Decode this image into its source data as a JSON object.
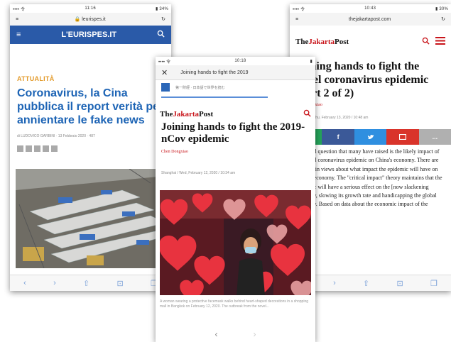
{
  "phone1": {
    "status_left": "•••• 令",
    "status_time": "11:16",
    "status_right": "▮ 34%",
    "url": "🔒 leurispes.it",
    "site_name": "L'EURISPES.IT",
    "section": "ATTUALITÀ",
    "headline": "Coronavirus, la Cina pubblica il report verità per annientare le fake news",
    "byline": "di LUDOVICO GARBINI · 13 Febbraio 2020 · 487"
  },
  "phone2": {
    "status_left": "•••• 令",
    "status_time": "10:18",
    "status_right": "▮",
    "tab_title": "Joining hands to fight the 2019",
    "banner_text": "第一財經 · 日本語で世界を読む",
    "logo_a": "The",
    "logo_b": "Jakarta",
    "logo_c": "Post",
    "headline": "Joining hands to fight the 2019-nCov epidemic",
    "author": "Chen Dongxiao",
    "dateline": "Shanghai / Wed, February 12, 2020 / 10:34 am",
    "caption": "A woman wearing a protective facemask walks behind heart-shaped decorations in a shopping mall in Bangkok on February 12, 2020. The outbreak from the novel..."
  },
  "phone3": {
    "status_left": "•••• 令",
    "status_time": "10:43",
    "status_right": "▮ 30%",
    "url": "thejakartapost.com",
    "logo_a": "The",
    "logo_b": "Jakarta",
    "logo_c": "Post",
    "headline": "Joining hands to fight the novel coronavirus epidemic (Part 2 of 2)",
    "author": "Chen Dongxiao",
    "dateline": "Shanghai / Thu, February 13, 2020 / 10:48 am",
    "share_labels": [
      "",
      "f",
      "",
      "",
      "..."
    ],
    "body": "The third question that many have raised is the likely impact of the novel coronavirus epidemic on China's economy. There are three main views about what impact the epidemic will have on China's economy. The \"critical impact\" theory maintains that the epidemic will have a serious effect on the [now slackening economy, slowing its growth rate and handicapping the global economy. Based on data about the economic impact of the"
  },
  "colors": {
    "eurispes_blue": "#2a5aa8",
    "jakarta_red": "#c8141a",
    "section_orange": "#e39a2a",
    "whatsapp": "#25a35a",
    "facebook": "#3b5998",
    "twitter": "#2f8fe0",
    "email": "#d9342b",
    "more": "#b0b0b0"
  }
}
